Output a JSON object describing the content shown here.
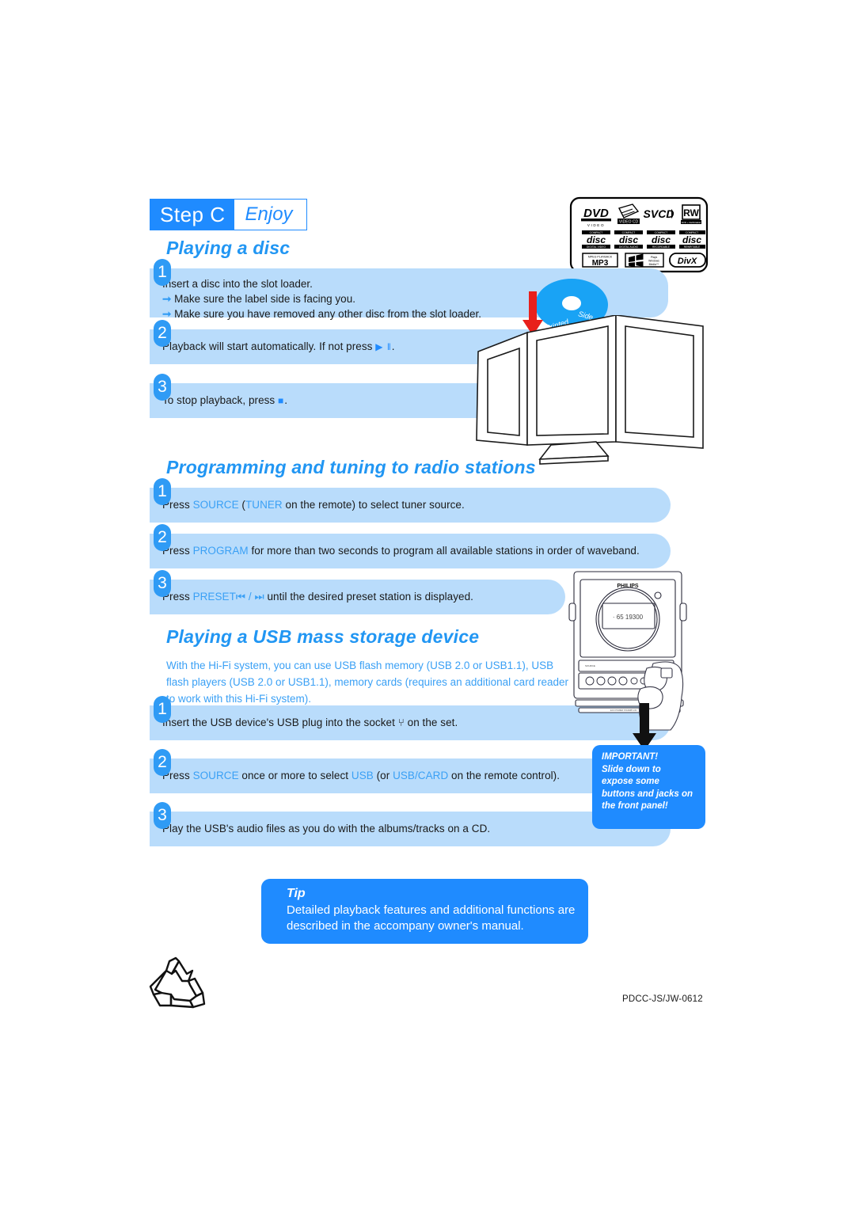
{
  "header": {
    "step_label": "Step C",
    "step_mode": "Enjoy"
  },
  "sections": {
    "disc": {
      "title": "Playing a disc",
      "steps": [
        {
          "number": "1",
          "lines": [
            "Insert a disc into the slot loader.",
            "Make sure the label side is facing you.",
            "Make sure you have removed any other disc from the slot loader."
          ]
        },
        {
          "number": "2",
          "text_before": "Playback will start automatically. If not press ",
          "glyph": "▶ ‖",
          "text_after": "."
        },
        {
          "number": "3",
          "text_before": "To stop playback, press ",
          "glyph": "■",
          "text_after": "."
        }
      ]
    },
    "radio": {
      "title": "Programming and tuning to radio stations",
      "steps": [
        {
          "number": "1",
          "parts": [
            {
              "t": "Press ",
              "hl": false
            },
            {
              "t": "SOURCE ",
              "hl": true
            },
            {
              "t": "(",
              "hl": false
            },
            {
              "t": "TUNER",
              "hl": true
            },
            {
              "t": "  on the remote) to select tuner source.",
              "hl": false
            }
          ]
        },
        {
          "number": "2",
          "parts": [
            {
              "t": "Press ",
              "hl": false
            },
            {
              "t": "PROGRAM",
              "hl": true
            },
            {
              "t": "  for more than two seconds to program all available stations in order of waveband.",
              "hl": false
            }
          ]
        },
        {
          "number": "3",
          "parts": [
            {
              "t": "Press ",
              "hl": false
            },
            {
              "t": "PRESET",
              "hl": true
            },
            {
              "t": "⏮ / ⏭",
              "hl": true
            },
            {
              "t": " until the desired preset station is displayed.",
              "hl": false
            }
          ]
        }
      ]
    },
    "usb": {
      "title": "Playing a USB mass storage device",
      "intro": "With the Hi-Fi system, you can use USB flash memory (USB 2.0 or USB1.1), USB flash players (USB 2.0 or USB1.1), memory cards (requires an additional card reader  to work with this Hi-Fi system).",
      "steps": [
        {
          "number": "1",
          "parts": [
            {
              "t": "Insert the USB device's USB plug into the socket ",
              "hl": false
            },
            {
              "t": "⑂",
              "hl": false
            },
            {
              "t": " on the set.",
              "hl": false
            }
          ]
        },
        {
          "number": "2",
          "parts": [
            {
              "t": "Press ",
              "hl": false
            },
            {
              "t": "SOURCE",
              "hl": true
            },
            {
              "t": " once or more to select ",
              "hl": false
            },
            {
              "t": "USB",
              "hl": true
            },
            {
              "t": " (or ",
              "hl": false
            },
            {
              "t": "USB/CARD",
              "hl": true
            },
            {
              "t": "  on the remote control).",
              "hl": false
            }
          ]
        },
        {
          "number": "3",
          "parts": [
            {
              "t": "Play the USB's audio files as you do with the albums/tracks on a CD.",
              "hl": false
            }
          ]
        }
      ]
    }
  },
  "tip": {
    "title": "Tip",
    "body": "Detailed playback features and additional functions are described in the accompany owner's manual."
  },
  "important": {
    "line1": "IMPORTANT!",
    "line2": "Slide down to",
    "line3": "expose some",
    "line4": "buttons and jacks on",
    "line5": "the front panel!"
  },
  "artwork": {
    "disc_label": "Printed  Side",
    "brand": "PHILIPS",
    "display_value": "65  19300",
    "logos": {
      "row1": [
        "DVD VIDEO",
        "VIDEO CD",
        "SVCD",
        "RW"
      ],
      "row2": [
        "disc DIGITAL VIDEO",
        "disc DIGITAL AUDIO",
        "disc RECORDABLE",
        "disc REWRITABLE"
      ],
      "row3": [
        "MP3",
        "Windows Media Audio",
        "DivX"
      ]
    }
  },
  "footer": {
    "code": "PDCC-JS/JW-0612"
  },
  "colors": {
    "brand_blue": "#1f8bff",
    "bar_blue": "#b9dcfb",
    "badge_blue": "#2f9bf5",
    "title_blue": "#2196f3",
    "link_blue": "#3aa0f5",
    "arrow_red": "#e8201b"
  }
}
